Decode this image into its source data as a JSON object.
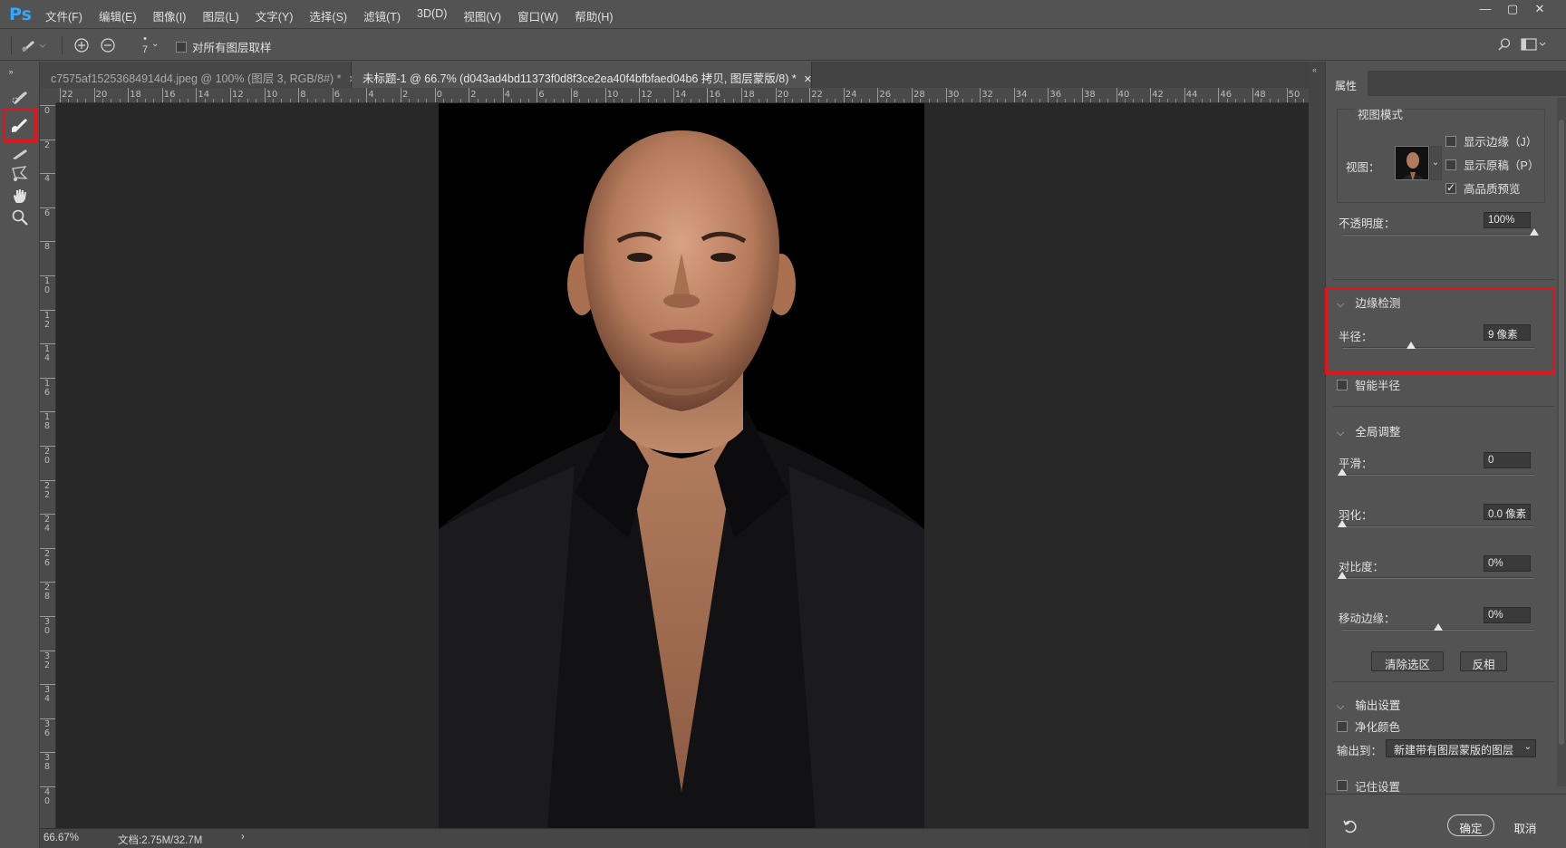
{
  "app": {
    "logo": "Ps"
  },
  "menu": [
    "文件(F)",
    "编辑(E)",
    "图像(I)",
    "图层(L)",
    "文字(Y)",
    "选择(S)",
    "滤镜(T)",
    "3D(D)",
    "视图(V)",
    "窗口(W)",
    "帮助(H)"
  ],
  "window_controls": {
    "minimize": "—",
    "restore": "▢",
    "close": "✕"
  },
  "options": {
    "brush_size": "7",
    "sample_all_layers_label": "对所有图层取样",
    "sample_all_layers_checked": false
  },
  "tabs": [
    {
      "label": "c7575af15253684914d4.jpeg @ 100% (图层 3, RGB/8#) *",
      "close": "✕",
      "active": false
    },
    {
      "label": "未标题-1 @ 66.7% (d043ad4bd11373f0d8f3ce2ea40f4bfbfaed04b6 拷贝, 图层蒙版/8) *",
      "close": "✕",
      "active": true
    }
  ],
  "ruler": {
    "top_labels": [
      "22",
      "20",
      "18",
      "16",
      "14",
      "12",
      "10",
      "8",
      "6",
      "4",
      "2",
      "0",
      "2",
      "4",
      "6",
      "8",
      "10",
      "12",
      "14",
      "16",
      "18",
      "20",
      "22",
      "24",
      "26",
      "28",
      "30",
      "32",
      "34",
      "36",
      "38",
      "40",
      "42",
      "44",
      "46",
      "48",
      "50"
    ],
    "left_labels": [
      "0",
      "2",
      "4",
      "6",
      "8",
      "10",
      "12",
      "14",
      "16",
      "18",
      "20",
      "22",
      "24",
      "26",
      "28",
      "30",
      "32",
      "34",
      "36",
      "38",
      "40"
    ]
  },
  "status": {
    "zoom": "66.67%",
    "doc": "文档:2.75M/32.7M",
    "arrow": "›"
  },
  "properties": {
    "tab": "属性",
    "view_mode": {
      "title": "视图模式",
      "view_label": "视图：",
      "show_edge": {
        "label": "显示边缘（J）",
        "checked": false
      },
      "show_original": {
        "label": "显示原稿（P）",
        "checked": false
      },
      "hq_preview": {
        "label": "高品质预览",
        "checked": true
      }
    },
    "opacity": {
      "label": "不透明度：",
      "value": "100%",
      "level": 1.0
    },
    "edge_detection": {
      "title": "边缘检测",
      "radius": {
        "label": "半径：",
        "value": "9 像素",
        "level": 0.36
      },
      "smart_radius": {
        "label": "智能半径",
        "checked": false
      }
    },
    "global": {
      "title": "全局调整",
      "smooth": {
        "label": "平滑：",
        "value": "0",
        "level": 0.0
      },
      "feather": {
        "label": "羽化：",
        "value": "0.0 像素",
        "level": 0.0
      },
      "contrast": {
        "label": "对比度：",
        "value": "0%",
        "level": 0.0
      },
      "shift_edge": {
        "label": "移动边缘：",
        "value": "0%",
        "level": 0.5
      },
      "clear_selection": "清除选区",
      "invert": "反相"
    },
    "output": {
      "title": "输出设置",
      "decontaminate": {
        "label": "净化颜色",
        "checked": false
      },
      "output_to_label": "输出到：",
      "output_to_value": "新建带有图层蒙版的图层"
    },
    "remember": {
      "label": "记住设置",
      "checked": false
    },
    "ok": "确定",
    "cancel": "取消"
  },
  "colors": {
    "highlight": "#e0141a",
    "panel": "#535353",
    "canvas_bg": "#282828"
  }
}
